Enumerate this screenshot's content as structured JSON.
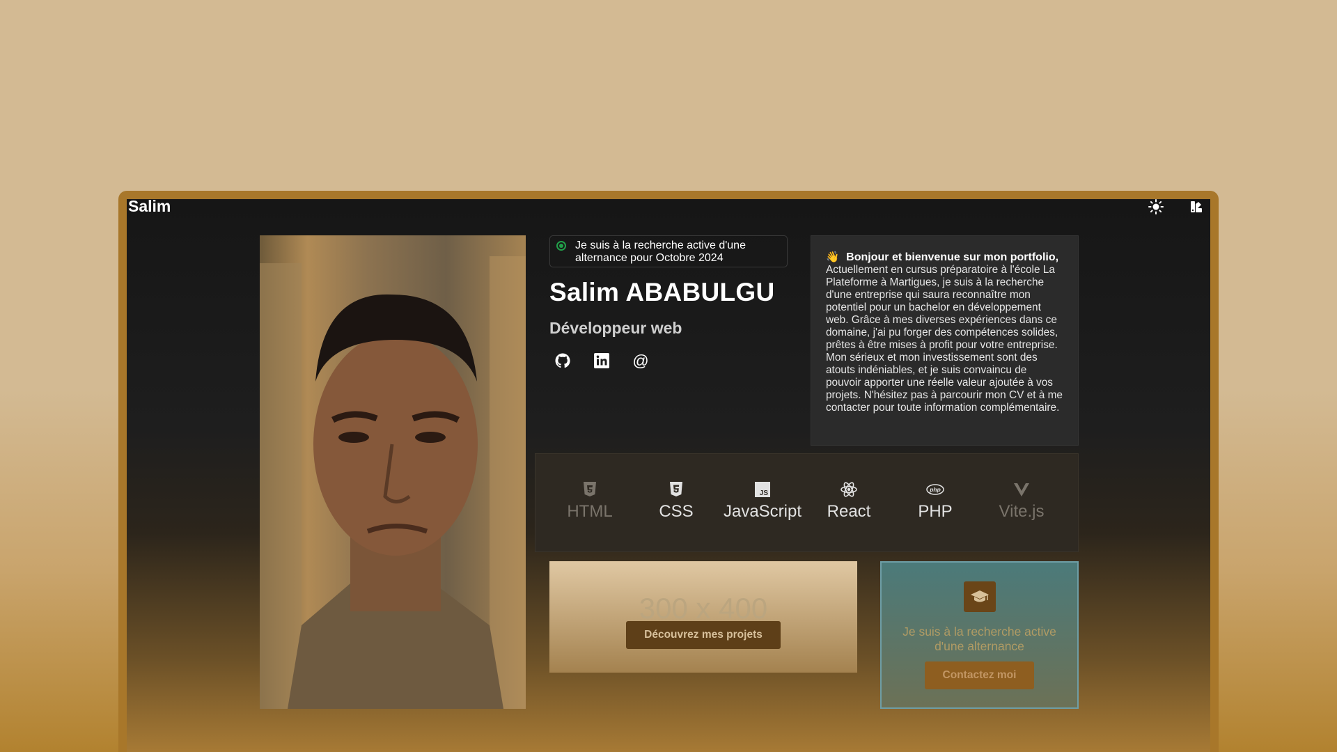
{
  "nav": {
    "brand": "Salim",
    "theme_icon": "sun-icon",
    "palette_icon": "palette-icon"
  },
  "profile": {
    "photo_alt": "",
    "status": "Je suis à la recherche active d'une alternance pour Octobre 2024",
    "name": "Salim ABABULGU",
    "role": "Développeur web",
    "socials": [
      {
        "icon": "github-icon"
      },
      {
        "icon": "linkedin-icon"
      },
      {
        "icon": "email-icon",
        "label": "@"
      }
    ]
  },
  "about": {
    "wave": "👋",
    "heading": "Bonjour et bienvenue sur mon portfolio,",
    "text": "Actuellement en cursus préparatoire à l'école La Plateforme à Martigues, je suis à la recherche d'une entreprise qui saura reconnaître mon potentiel pour un bachelor en développement web. Grâce à mes diverses expériences dans ce domaine, j'ai pu forger des compétences solides, prêtes à être mises à profit pour votre entreprise. Mon sérieux et mon investissement sont des atouts indéniables, et je suis convaincu de pouvoir apporter une réelle valeur ajoutée à vos projets. N'hésitez pas à parcourir mon CV et à me contacter pour toute information complémentaire."
  },
  "stack": {
    "items": [
      {
        "label": "HTML",
        "icon": "html5-icon",
        "color": "#7a746b"
      },
      {
        "label": "CSS",
        "icon": "css3-icon",
        "color": "#e2e2e2"
      },
      {
        "label": "JavaScript",
        "icon": "javascript-icon",
        "color": "#e2e2e2"
      },
      {
        "label": "React",
        "icon": "react-icon",
        "color": "#e2e2e2"
      },
      {
        "label": "PHP",
        "icon": "php-icon",
        "color": "#e2e2e2"
      },
      {
        "label": "Vite.js",
        "icon": "vite-icon",
        "color": "#7a746b"
      }
    ]
  },
  "projects": {
    "placeholder": "300 x 400",
    "button": "Découvrez mes projets"
  },
  "alternance": {
    "icon": "graduation-cap-icon",
    "text": "Je suis à la recherche active d'une alternance",
    "button": "Contactez moi"
  }
}
